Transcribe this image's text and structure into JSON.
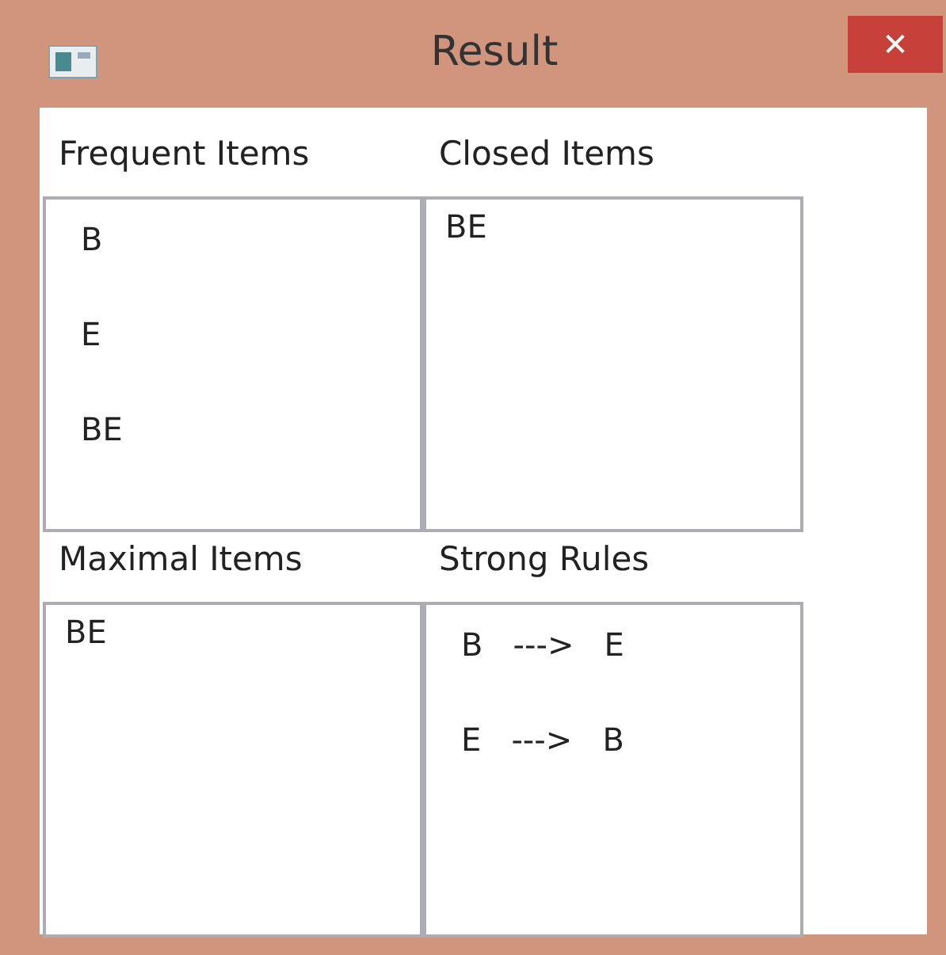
{
  "window": {
    "title": "Result",
    "close": "✕"
  },
  "panels": [
    {
      "label": "Frequent Items",
      "kind": "spaced",
      "items": [
        "B",
        "E",
        "BE"
      ]
    },
    {
      "label": "Closed Items",
      "kind": "compact",
      "items": [
        "BE"
      ]
    },
    {
      "label": "Maximal Items",
      "kind": "compact",
      "items": [
        "BE"
      ]
    },
    {
      "label": "Strong Rules",
      "kind": "spaced",
      "items": [
        "B   --->   E",
        "E   --->   B"
      ]
    }
  ]
}
